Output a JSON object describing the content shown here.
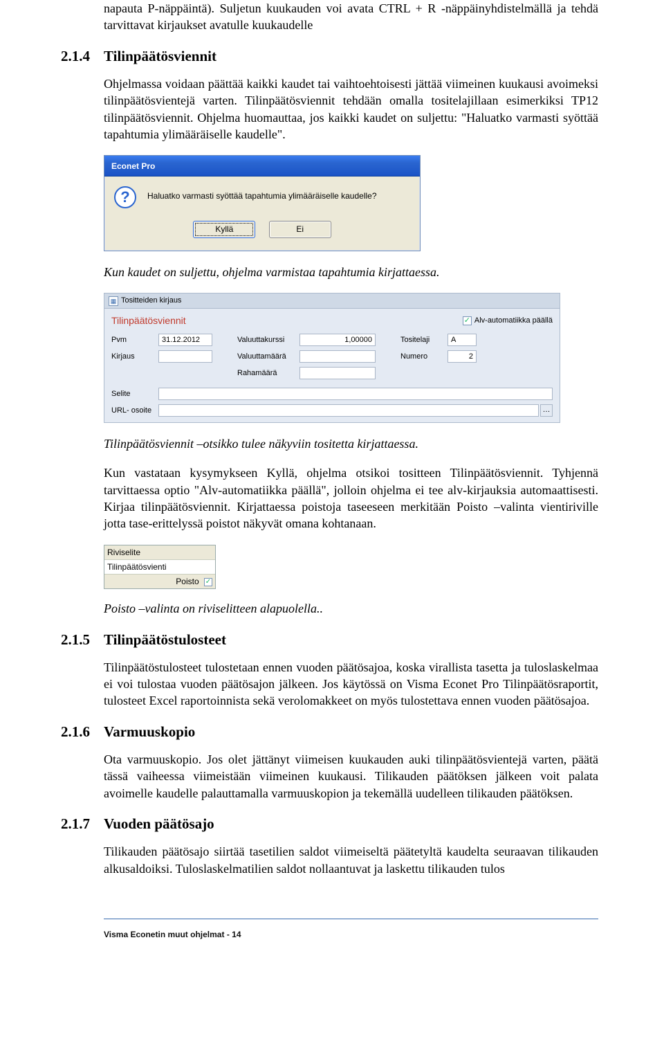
{
  "p_intro1": "napauta P-näppäintä). Suljetun kuukauden voi avata CTRL + R -näppäinyhdistelmällä ja tehdä tarvittavat kirjaukset avatulle kuukaudelle",
  "s214": {
    "num": "2.1.4",
    "title": "Tilinpäätösviennit",
    "p1": "Ohjelmassa voidaan päättää kaikki kaudet tai vaihtoehtoisesti jättää viimeinen kuukausi avoimeksi tilinpäätösvientejä varten. Tilinpäätösviennit tehdään omalla tositelajillaan esimerkiksi TP12 tilinpäätösviennit. Ohjelma huomauttaa, jos kaikki kaudet on suljettu: \"Haluatko varmasti syöttää tapahtumia ylimääräiselle kaudelle\".",
    "cap1": "Kun kaudet on suljettu, ohjelma varmistaa tapahtumia kirjattaessa.",
    "cap2": "Tilinpäätösviennit –otsikko tulee näkyviin tositetta kirjattaessa.",
    "p2": "Kun vastataan kysymykseen Kyllä, ohjelma otsikoi tositteen Tilinpäätösviennit. Tyhjennä tarvittaessa optio \"Alv-automatiikka päällä\", jolloin ohjelma ei tee alv-kirjauksia automaattisesti. Kirjaa tilinpäätösviennit. Kirjattaessa poistoja taseeseen merkitään Poisto –valinta vientiriville jotta tase-erittelyssä poistot näkyvät omana kohtanaan.",
    "cap3": "Poisto –valinta on  riviselitteen alapuolella.."
  },
  "dialog1": {
    "title": "Econet Pro",
    "text": "Haluatko varmasti syöttää tapahtumia ylimääräiselle kaudelle?",
    "yes": "Kyllä",
    "no": "Ei"
  },
  "form": {
    "tab": "Tositteiden kirjaus",
    "headline": "Tilinpäätösviennit",
    "alv_label": "Alv-automatiikka päällä",
    "labels": {
      "pvm": "Pvm",
      "kirjaus": "Kirjaus",
      "valuuttakurssi": "Valuuttakurssi",
      "valuuttamaara": "Valuuttamäärä",
      "rahamaara": "Rahamäärä",
      "tositelaji": "Tositelaji",
      "numero": "Numero",
      "selite": "Selite",
      "url": "URL- osoite"
    },
    "values": {
      "pvm": "31.12.2012",
      "kurssi": "1,00000",
      "laji": "A",
      "numero": "2"
    }
  },
  "rivi": {
    "hdr": "Riviselite",
    "text": "Tilinpäätösvienti",
    "footer": "Poisto"
  },
  "s215": {
    "num": "2.1.5",
    "title": "Tilinpäätöstulosteet",
    "p1": "Tilinpäätöstulosteet tulostetaan ennen vuoden päätösajoa, koska virallista tasetta ja tuloslaskelmaa ei voi tulostaa vuoden päätösajon jälkeen. Jos käytössä on Visma Econet Pro Tilinpäätösraportit, tulosteet Excel raportoinnista sekä verolomakkeet on myös tulostettava ennen vuoden päätösajoa."
  },
  "s216": {
    "num": "2.1.6",
    "title": "Varmuuskopio",
    "p1": "Ota varmuuskopio. Jos olet jättänyt viimeisen kuukauden auki tilinpäätösvientejä varten, päätä tässä vaiheessa viimeistään viimeinen kuukausi. Tilikauden päätöksen jälkeen voit palata avoimelle kaudelle palauttamalla varmuuskopion ja tekemällä uudelleen tilikauden päätöksen."
  },
  "s217": {
    "num": "2.1.7",
    "title": "Vuoden päätösajo",
    "p1": "Tilikauden päätösajo siirtää tasetilien saldot viimeiseltä päätetyltä kaudelta seuraavan tilikauden alkusaldoiksi. Tuloslaskelmatilien saldot nollaantuvat ja laskettu tilikauden tulos"
  },
  "footer": "Visma Econetin muut ohjelmat - 14"
}
